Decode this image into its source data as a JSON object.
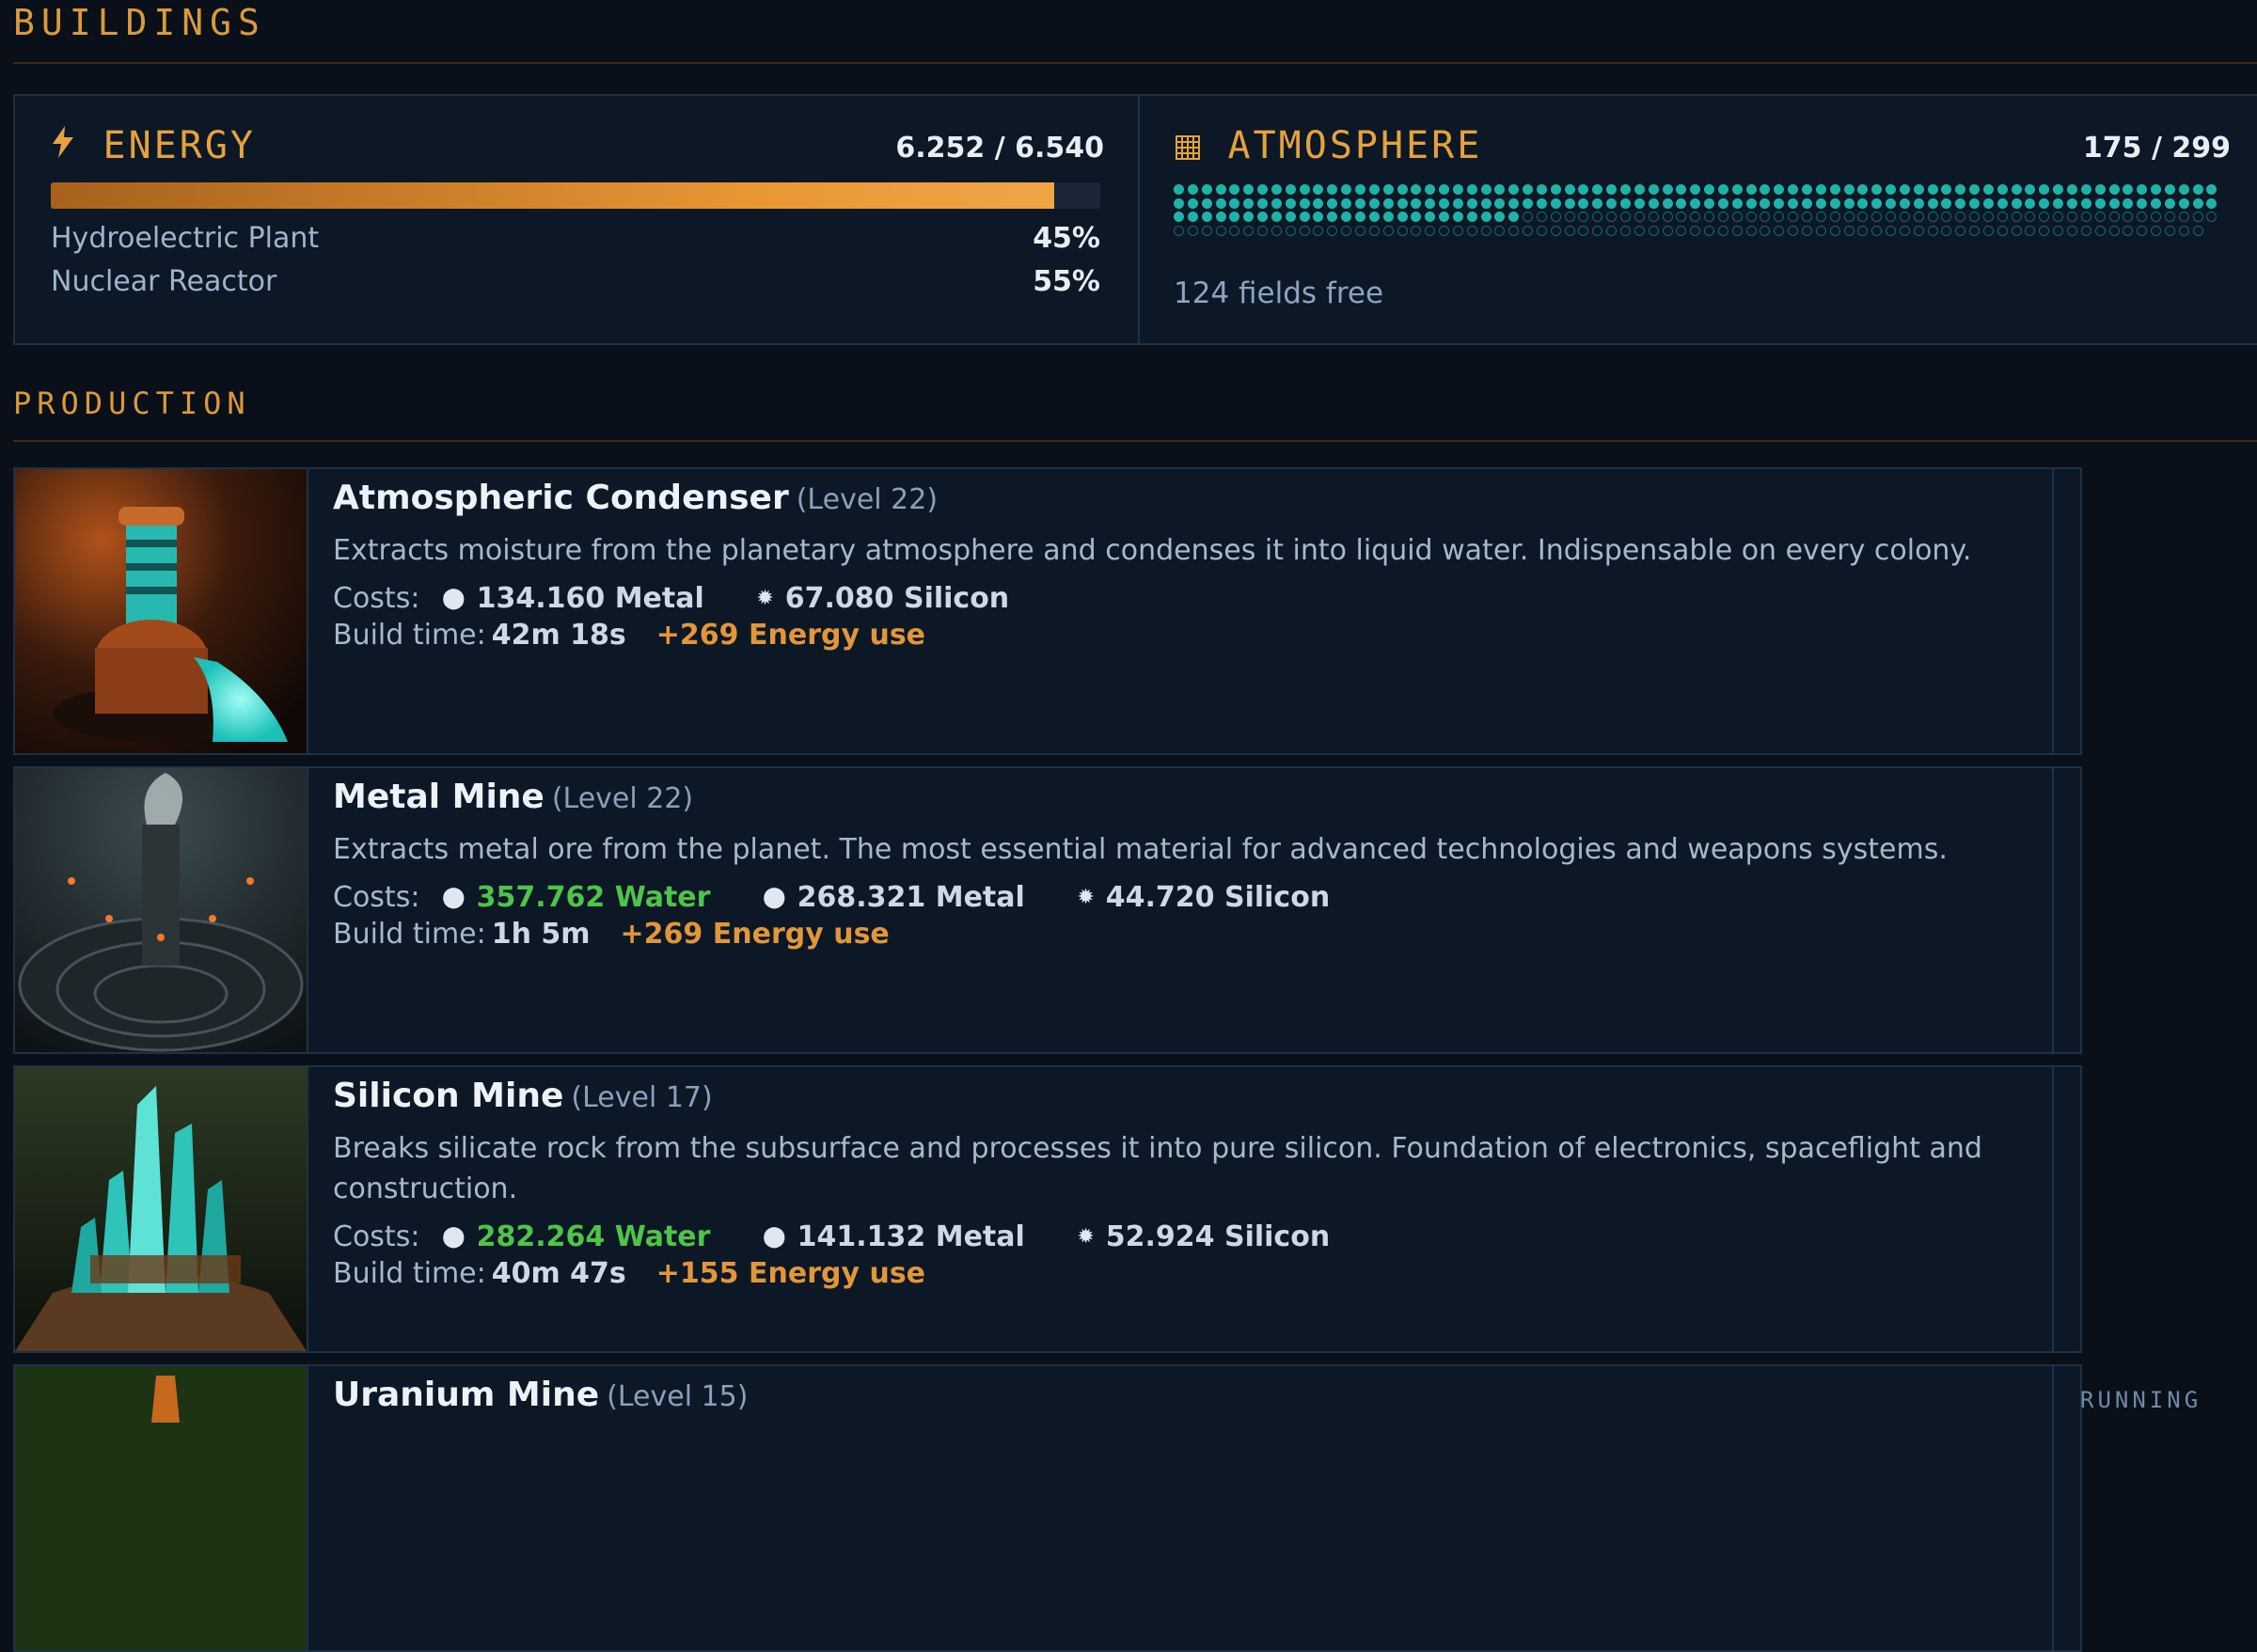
{
  "header": {
    "title": "BUILDINGS"
  },
  "energy": {
    "title": "ENERGY",
    "icon": "lightning-icon",
    "value": "6.252 / 6.540",
    "fill_fraction": 0.956,
    "sources": [
      {
        "name": "Hydroelectric Plant",
        "percent": "45%"
      },
      {
        "name": "Nuclear Reactor",
        "percent": "55%"
      }
    ]
  },
  "atmosphere": {
    "title": "ATMOSPHERE",
    "icon": "grid-icon",
    "value": "175 / 299",
    "used": 175,
    "total": 299,
    "free_text": "124 fields free"
  },
  "production": {
    "title": "PRODUCTION",
    "buildings": [
      {
        "name": "Atmospheric Condenser",
        "level": "(Level 22)",
        "description": "Extracts moisture from the planetary atmosphere and condenses it into liquid water. Indispensable on every colony.",
        "costs_label": "Costs:",
        "costs": [
          {
            "icon": "metal-icon",
            "amount": "134.160 Metal",
            "kind": "metal"
          },
          {
            "icon": "silicon-icon",
            "amount": "67.080 Silicon",
            "kind": "silicon"
          }
        ],
        "build_time_label": "Build time:",
        "build_time": "42m 18s",
        "energy_use": "+269 Energy use"
      },
      {
        "name": "Metal Mine",
        "level": "(Level 22)",
        "description": "Extracts metal ore from the planet. The most essential material for advanced technologies and weapons systems.",
        "costs_label": "Costs:",
        "costs": [
          {
            "icon": "water-icon",
            "amount": "357.762 Water",
            "kind": "water"
          },
          {
            "icon": "metal-icon",
            "amount": "268.321 Metal",
            "kind": "metal"
          },
          {
            "icon": "silicon-icon",
            "amount": "44.720 Silicon",
            "kind": "silicon"
          }
        ],
        "build_time_label": "Build time:",
        "build_time": "1h 5m",
        "energy_use": "+269 Energy use"
      },
      {
        "name": "Silicon Mine",
        "level": "(Level 17)",
        "description": "Breaks silicate rock from the subsurface and processes it into pure silicon. Foundation of electronics, spaceflight and construction.",
        "costs_label": "Costs:",
        "costs": [
          {
            "icon": "water-icon",
            "amount": "282.264 Water",
            "kind": "water"
          },
          {
            "icon": "metal-icon",
            "amount": "141.132 Metal",
            "kind": "metal"
          },
          {
            "icon": "silicon-icon",
            "amount": "52.924 Silicon",
            "kind": "silicon"
          }
        ],
        "build_time_label": "Build time:",
        "build_time": "40m 47s",
        "energy_use": "+155 Energy use"
      },
      {
        "name": "Uranium Mine",
        "level": "(Level 15)",
        "side_label": "RUNNING"
      }
    ]
  },
  "colors": {
    "accent": "#e5a23e",
    "water": "#4fc34a",
    "atmosphere": "#1fb3a8",
    "background": "#0a1019"
  }
}
